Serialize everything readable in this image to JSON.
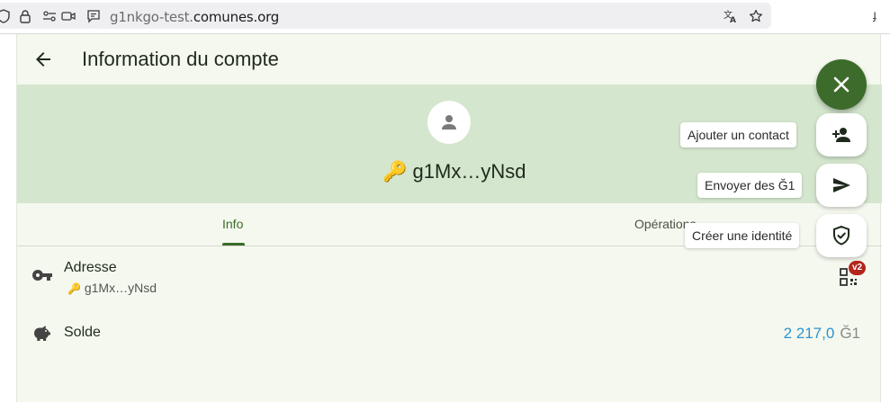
{
  "browser": {
    "url_prefix": "g1nkgo-test.",
    "url_domain": "comunes.org",
    "icons": [
      "shield-icon",
      "lock-icon",
      "permissions-icon",
      "camera-icon",
      "reader-icon",
      "translate-icon",
      "bookmark-star-icon"
    ]
  },
  "appbar": {
    "title": "Information du compte"
  },
  "header": {
    "key_emoji": "🔑",
    "name": "g1Mx…yNsd"
  },
  "tabs": [
    {
      "label": "Info",
      "selected": true
    },
    {
      "label": "Opérations",
      "selected": false
    }
  ],
  "address": {
    "title": "Adresse",
    "key_emoji": "🔑",
    "value": "g1Mx…yNsd",
    "qr_badge": "v2"
  },
  "balance": {
    "title": "Solde",
    "amount": "2 217,0",
    "currency": "Ğ1"
  },
  "speed_dial": {
    "actions": [
      {
        "label": "Ajouter un contact",
        "icon": "person-add-icon"
      },
      {
        "label": "Envoyer des Ğ1",
        "icon": "send-icon"
      },
      {
        "label": "Créer une identité",
        "icon": "verified-shield-icon"
      }
    ],
    "close_icon": "close-icon"
  },
  "colors": {
    "primary": "#3d6b2c",
    "header_bg": "#d4e6cd",
    "page_bg": "#f5f8ee",
    "amount": "#2b94d6",
    "badge": "#b3261e"
  }
}
